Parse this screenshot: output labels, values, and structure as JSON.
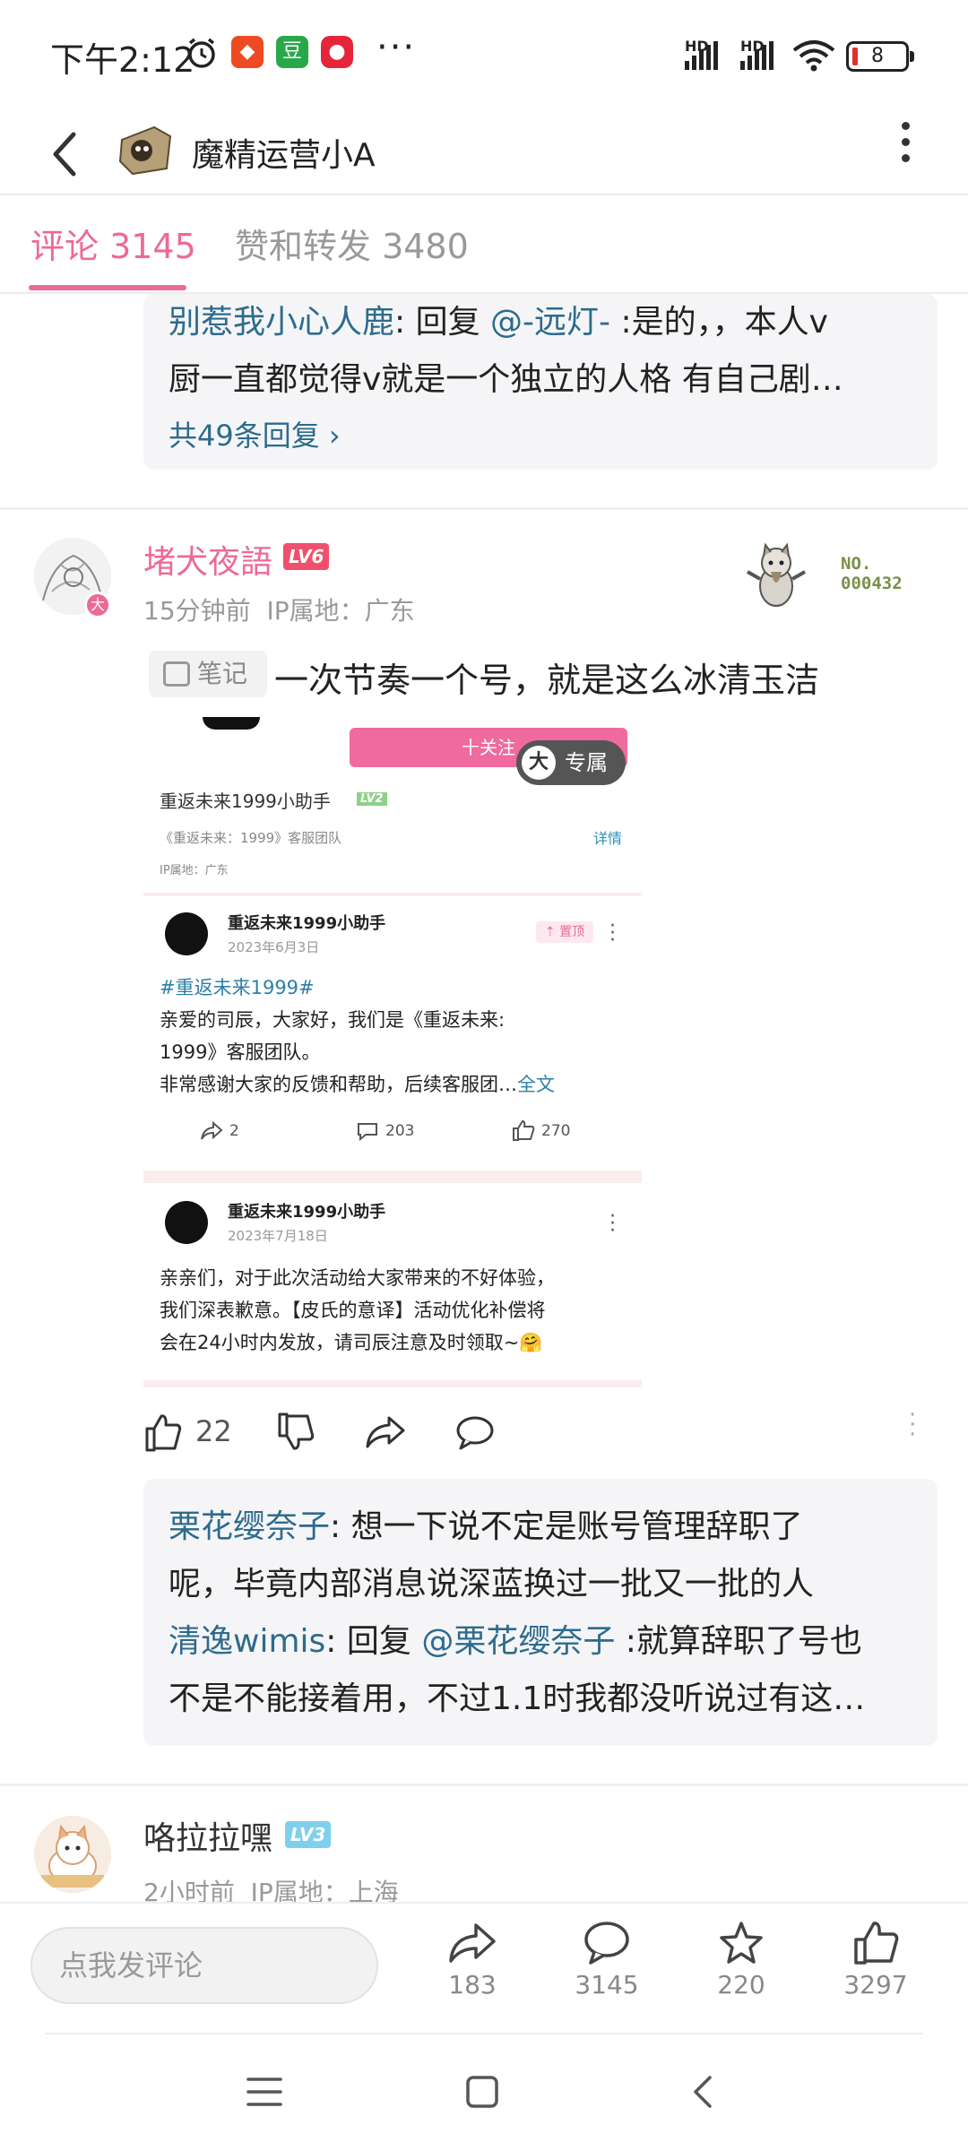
{
  "status_bar": {
    "time": "下午2:12",
    "signal_1": "HD",
    "signal_2": "HD",
    "battery": "8"
  },
  "header": {
    "title": "魔精运营小A"
  },
  "tabs": [
    {
      "label": "评论 3145",
      "active": true
    },
    {
      "label": "赞和转发 3480",
      "active": false
    }
  ],
  "prev_comment": {
    "reply_user": "别惹我小心人鹿",
    "reply_prefix": ": 回复 ",
    "reply_mention": "@-远灯-",
    "reply_text_1": " :是的，，本人v",
    "reply_text_2": "厨一直都觉得v就是一个独立的人格 有自己剧…",
    "more_replies": "共49条回复 ›"
  },
  "comment1": {
    "username": "堵犬夜語",
    "level": "LV6",
    "time": "15分钟前",
    "ip": "IP属地：广东",
    "badge_no": "NO.",
    "badge_num": "000432",
    "note_tag": "笔记",
    "text": "一次节奏一个号，就是这么冰清玉洁",
    "likes": "22",
    "screenshot": {
      "follow_btn": "十关注",
      "exclusive": "专属",
      "exclusive_badge": "大",
      "account_name": "重返未来1999小助手",
      "account_level": "LV2",
      "account_desc": "《重返未来：1999》客服团队",
      "details": "详情",
      "account_ip": "IP属地：广东",
      "post1": {
        "name": "重返未来1999小助手",
        "date": "2023年6月3日",
        "pin": "置顶",
        "hashtag": "#重返未来1999#",
        "body_1": "亲爱的司辰，大家好，我们是《重返未来:",
        "body_2": "1999》客服团队。",
        "body_3": "非常感谢大家的反馈和帮助，后续客服团…",
        "read_more": "全文",
        "shares": "2",
        "comments": "203",
        "likes": "270"
      },
      "post2": {
        "name": "重返未来1999小助手",
        "date": "2023年7月18日",
        "body_1": "亲亲们，对于此次活动给大家带来的不好体验，",
        "body_2": "我们深表歉意。【皮氏的意译】活动优化补偿将",
        "body_3": "会在24小时内发放，请司辰注意及时领取~🤗"
      }
    },
    "replies": {
      "r1_user": "栗花缨奈子",
      "r1_text_1": ": 想一下说不定是账号管理辞职了",
      "r1_text_2": "呢，毕竟内部消息说深蓝换过一批又一批的人",
      "r2_user": "清逸wimis",
      "r2_prefix": ": 回复 ",
      "r2_mention": "@栗花缨奈子",
      "r2_text_1": " :就算辞职了号也",
      "r2_text_2": "不是不能接着用，不过1.1时我都没听说过有这…"
    }
  },
  "comment2": {
    "username": "咯拉拉嘿",
    "level": "LV3",
    "time": "2小时前",
    "ip": "IP属地：上海"
  },
  "bottom_bar": {
    "input_placeholder": "点我发评论",
    "shares": "183",
    "comments": "3145",
    "favorites": "220",
    "likes": "3297"
  },
  "colors": {
    "accent_pink": "#ec6a96",
    "link_blue": "#2d6b8c",
    "level6": "#f0506e",
    "level3": "#7ed0ec"
  }
}
